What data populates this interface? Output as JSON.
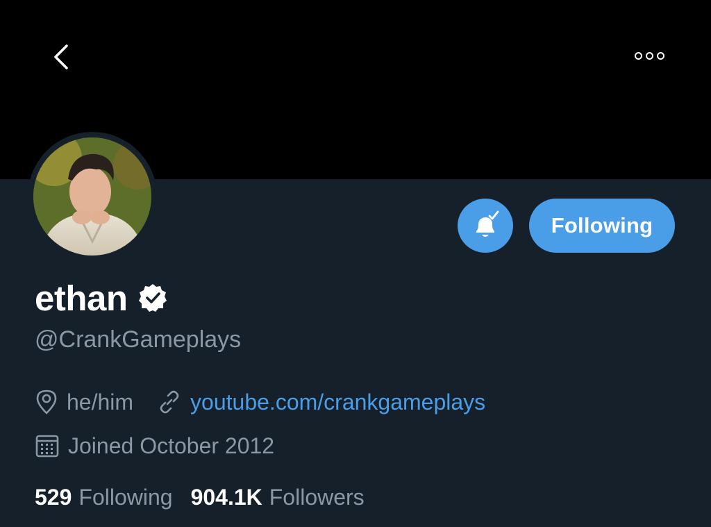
{
  "header": {
    "back_icon": "chevron-left-icon",
    "more_icon": "more-horizontal-icon"
  },
  "profile": {
    "name": "ethan",
    "verified": true,
    "handle": "@CrankGameplays",
    "pronouns": "he/him",
    "website": "youtube.com/crankgameplays",
    "joined": "Joined October 2012"
  },
  "actions": {
    "notifications_icon": "bell-check-icon",
    "following_label": "Following"
  },
  "stats": {
    "following_count": "529",
    "following_label": "Following",
    "followers_count": "904.1K",
    "followers_label": "Followers"
  },
  "colors": {
    "background": "#15202b",
    "banner": "#000000",
    "accent": "#4a9ee8",
    "secondary_text": "#8b98a5"
  }
}
